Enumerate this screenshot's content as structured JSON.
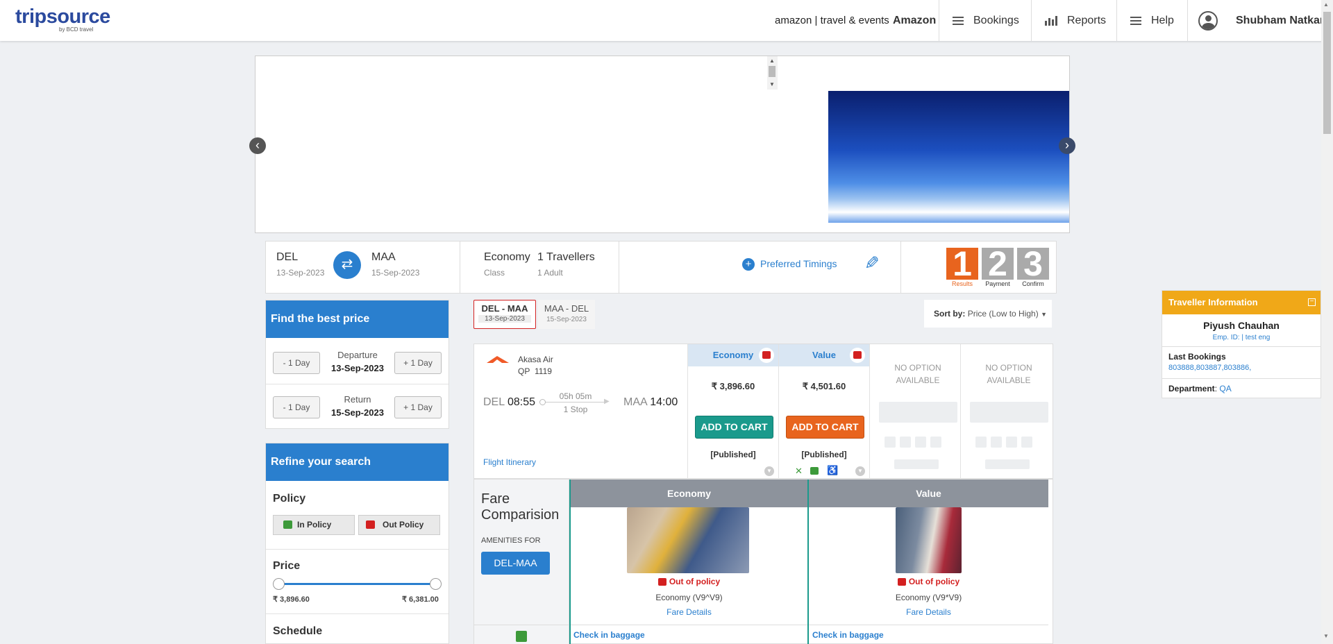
{
  "header": {
    "logo_main": "tripsource",
    "logo_sub": "by BCD travel",
    "partner": "amazon | travel & events",
    "company": "Amazon",
    "nav": [
      "Bookings",
      "Reports",
      "Help"
    ],
    "user": "Shubham Natkar"
  },
  "search": {
    "origin": "DEL",
    "origin_date": "13-Sep-2023",
    "destination": "MAA",
    "destination_date": "15-Sep-2023",
    "class_value": "Economy",
    "class_label": "Class",
    "travellers_value": "1 Travellers",
    "travellers_label": "1 Adult",
    "preferred_timings": "Preferred Timings",
    "steps": [
      {
        "num": "1",
        "label": "Results"
      },
      {
        "num": "2",
        "label": "Payment"
      },
      {
        "num": "3",
        "label": "Confirm"
      }
    ]
  },
  "best_price": {
    "title": "Find the best price",
    "minus": "- 1 Day",
    "plus": "+ 1 Day",
    "departure_label": "Departure",
    "departure_date": "13-Sep-2023",
    "return_label": "Return",
    "return_date": "15-Sep-2023"
  },
  "refine": {
    "title": "Refine your search",
    "policy_title": "Policy",
    "in_policy": "In Policy",
    "out_policy": "Out Policy",
    "price_title": "Price",
    "price_min": "₹ 3,896.60",
    "price_max": "₹ 6,381.00",
    "schedule_title": "Schedule"
  },
  "tabs": [
    {
      "route": "DEL - MAA",
      "date": "13-Sep-2023"
    },
    {
      "route": "MAA - DEL",
      "date": "15-Sep-2023"
    }
  ],
  "sort": {
    "label": "Sort by:",
    "value": "Price (Low to High)"
  },
  "flight": {
    "airline": "Akasa Air",
    "code": "QP",
    "number": "1119",
    "from": "DEL",
    "dep_time": "08:55",
    "duration": "05h 05m",
    "stops": "1 Stop",
    "to": "MAA",
    "arr_time": "14:00",
    "itinerary": "Flight Itinerary",
    "fares": [
      {
        "name": "Economy",
        "price": "₹ 3,896.60",
        "button": "ADD TO CART",
        "type": "[Published]",
        "color": "#1a9a8c"
      },
      {
        "name": "Value",
        "price": "₹ 4,501.60",
        "button": "ADD TO CART",
        "type": "[Published]",
        "color": "#e8641e"
      }
    ],
    "no_option": "NO OPTION AVAILABLE"
  },
  "fare_compare": {
    "title_line1": "Fare",
    "title_line2": "Comparision",
    "amenities": "AMENITIES FOR",
    "route_btn": "DEL-MAA",
    "columns": [
      {
        "name": "Economy",
        "policy": "Out of policy",
        "class": "Economy (V9^V9)",
        "details": "Fare Details",
        "baggage": "Check in baggage"
      },
      {
        "name": "Value",
        "policy": "Out of policy",
        "class": "Economy (V9*V9)",
        "details": "Fare Details",
        "baggage": "Check in baggage"
      }
    ]
  },
  "traveller": {
    "title": "Traveller Information",
    "name": "Piyush Chauhan",
    "emp": "Emp. ID: | test eng",
    "last_bookings_label": "Last Bookings",
    "last_bookings": "803888,803887,803886,",
    "department_label": "Department",
    "department": "QA"
  },
  "colors": {
    "primary": "#2a7fce",
    "accent_orange": "#e8641e",
    "teal": "#1a9a8c",
    "policy_red": "#d32020",
    "traveller_header": "#f0a818"
  }
}
